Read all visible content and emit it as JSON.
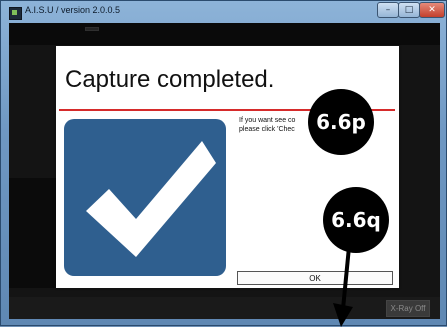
{
  "window": {
    "title": "A.I.S.U / version 2.0.0.5",
    "minimize_glyph": "–",
    "maximize_glyph": "□",
    "close_glyph": "✕"
  },
  "dialog": {
    "title": "Capture completed.",
    "message_line1": "If you want see co",
    "message_line2": "please click 'Chec",
    "ok_label": "OK",
    "icon": "checkmark-icon"
  },
  "annotations": {
    "callout_top": "6.6p",
    "callout_bottom": "6.6q"
  },
  "background_app": {
    "xray_label": "X-Ray Off"
  },
  "colors": {
    "title_rule": "#d62b2b",
    "check_tile": "#2f5f8f",
    "callout": "#000000"
  }
}
